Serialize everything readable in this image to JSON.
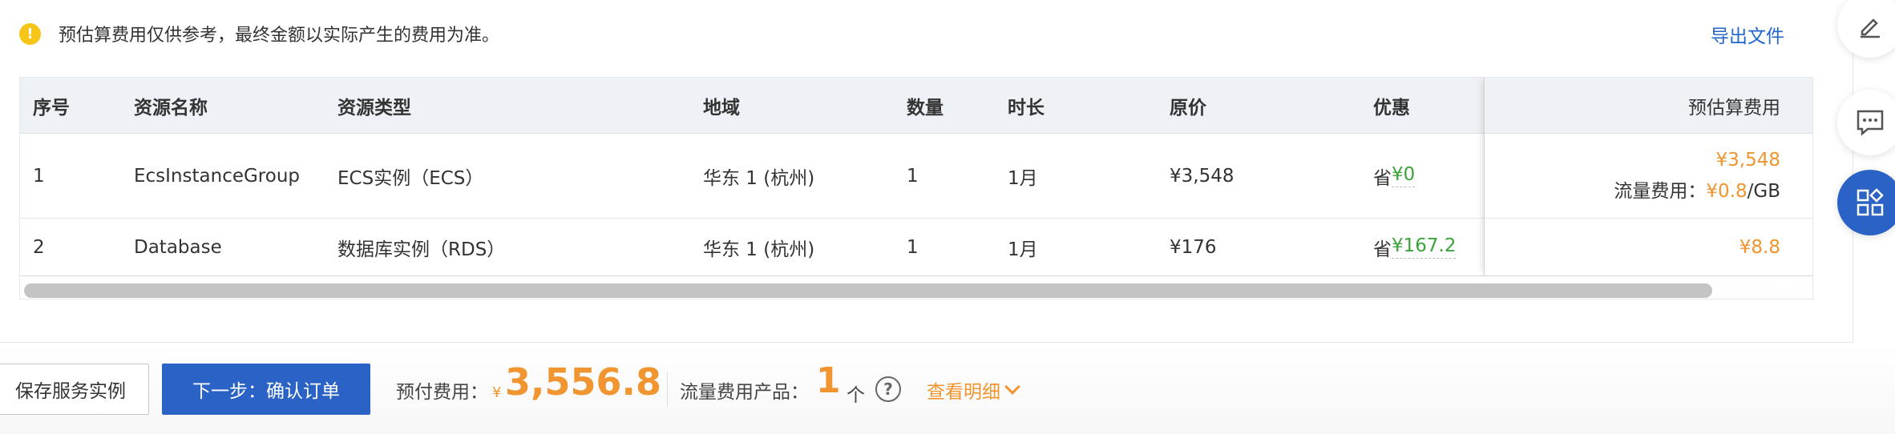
{
  "notice": {
    "text": "预估算费用仅供参考，最终金额以实际产生的费用为准。",
    "icon": "warning-icon",
    "icon_color": "#f5c518"
  },
  "export_label": "导出文件",
  "table": {
    "headers": {
      "seq": "序号",
      "name": "资源名称",
      "type": "资源类型",
      "region": "地域",
      "qty": "数量",
      "duration": "时长",
      "price": "原价",
      "discount": "优惠",
      "estimate": "预估算费用"
    },
    "rows": [
      {
        "seq": "1",
        "name": "EcsInstanceGroup",
        "type": "ECS实例（ECS）",
        "region": "华东 1 (杭州)",
        "qty": "1",
        "duration": "1月",
        "price": "¥3,548",
        "discount_prefix": "省",
        "discount_value": "¥0",
        "estimate": "¥3,548",
        "traffic_label": "流量费用：",
        "traffic_value": "¥0.8",
        "traffic_unit": "/GB"
      },
      {
        "seq": "2",
        "name": "Database",
        "type": "数据库实例（RDS）",
        "region": "华东 1 (杭州)",
        "qty": "1",
        "duration": "1月",
        "price": "¥176",
        "discount_prefix": "省",
        "discount_value": "¥167.2",
        "estimate": "¥8.8"
      }
    ]
  },
  "footer": {
    "save_label": "保存服务实例",
    "next_label": "下一步：确认订单",
    "prepay_label": "预付费用：",
    "prepay_currency": "¥",
    "prepay_amount": "3,556.8",
    "traffic_label": "流量费用产品：",
    "traffic_count": "1",
    "traffic_unit": "个",
    "help_glyph": "?",
    "detail_label": "查看明细"
  },
  "colors": {
    "accent": "#2a63c5",
    "price": "#f0952f",
    "discount": "#3aa33a",
    "link": "#2266cc"
  },
  "side_toolbar": [
    "edit-icon",
    "chat-icon",
    "apps-icon"
  ]
}
